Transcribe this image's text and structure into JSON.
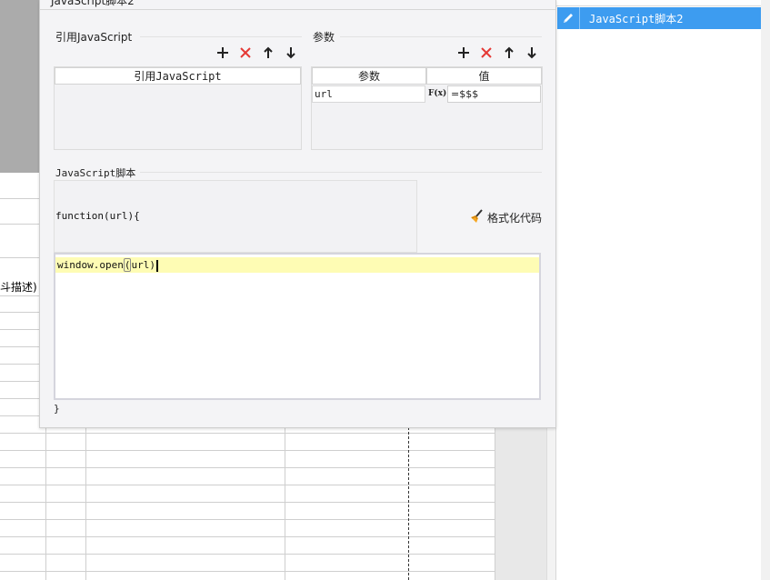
{
  "dialog": {
    "title": "JavaScript脚本2",
    "ref_js": {
      "section_title": "引用JavaScript",
      "column_header": "引用JavaScript",
      "toolbar": [
        {
          "name": "add-button",
          "glyph": "+"
        },
        {
          "name": "delete-button",
          "glyph": "✕"
        },
        {
          "name": "move-up-button",
          "glyph": "↑"
        },
        {
          "name": "move-down-button",
          "glyph": "↓"
        }
      ]
    },
    "params": {
      "section_title": "参数",
      "columns": [
        "参数",
        "值"
      ],
      "rows": [
        {
          "name": "url",
          "formula_icon": "F(x)",
          "value": "=$$$"
        }
      ]
    },
    "script": {
      "section_title": "JavaScript脚本",
      "signature": "function(url){",
      "format_label": "格式化代码",
      "code_before": "window.open",
      "code_paren": "(",
      "code_after": "url)",
      "closing_brace": "}"
    }
  },
  "right_panel": {
    "items": [
      {
        "label": "JavaScript脚本2",
        "icon": "pencil-icon",
        "selected": true
      }
    ]
  },
  "sheet": {
    "visible_cell_text": "斗描述)"
  },
  "colors": {
    "accent": "#3d9cf0",
    "delete_red": "#e53935",
    "highlight_line": "#fefcb4"
  }
}
